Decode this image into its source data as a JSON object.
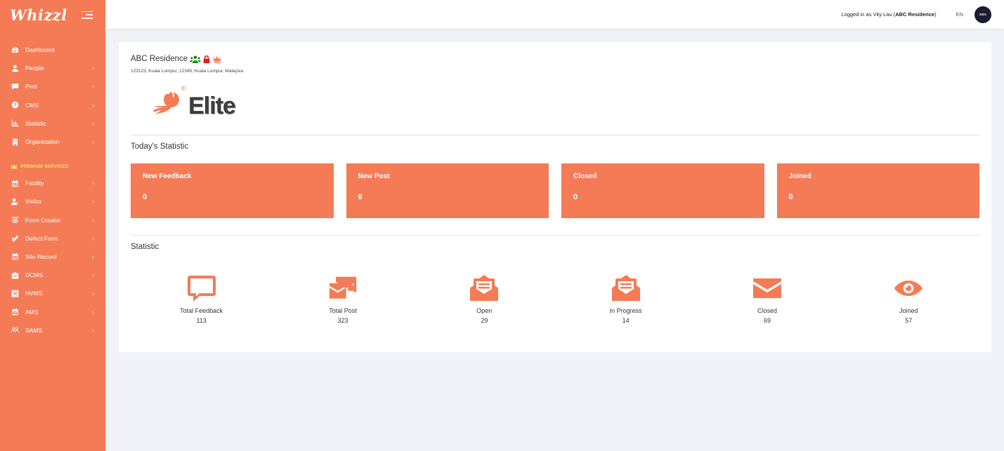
{
  "brand": {
    "name": "Whizzl"
  },
  "sidebar": {
    "items": [
      {
        "label": "Dashboard",
        "icon": "dashboard-icon",
        "has_children": false
      },
      {
        "label": "People",
        "icon": "user-icon",
        "has_children": true
      },
      {
        "label": "Post",
        "icon": "comment-icon",
        "has_children": true
      },
      {
        "label": "CMS",
        "icon": "question-circle-icon",
        "has_children": true
      },
      {
        "label": "Statistic",
        "icon": "chart-icon",
        "has_children": true
      },
      {
        "label": "Organization",
        "icon": "building-icon",
        "has_children": true
      }
    ],
    "premium_title": "PREMIUM SERVICES",
    "premium_items": [
      {
        "label": "Facility",
        "icon": "calendar-icon",
        "has_children": true
      },
      {
        "label": "Visitor",
        "icon": "user-check-icon",
        "has_children": true
      },
      {
        "label": "Form Creator",
        "icon": "align-icon",
        "has_children": true
      },
      {
        "label": "Defect Form",
        "icon": "check-double-icon",
        "has_children": true
      },
      {
        "label": "Site Record",
        "icon": "calendar-icon",
        "has_children": true
      },
      {
        "label": "DCMS",
        "icon": "briefcase-icon",
        "has_children": true
      },
      {
        "label": "HVMS",
        "icon": "h-square-icon",
        "has_children": true
      },
      {
        "label": "AMS",
        "icon": "calendar-check-icon",
        "has_children": true
      },
      {
        "label": "SAMS",
        "icon": "users-icon",
        "has_children": true
      }
    ],
    "chevron": "›"
  },
  "topbar": {
    "logged_in_prefix": "Logged in as Vky Lau (",
    "logged_in_org": "ABC Residence",
    "logged_in_suffix": ")",
    "language": "EN",
    "avatar_text": "2021"
  },
  "organization": {
    "name": "ABC Residence",
    "address": "123123, Kuala Lumpur, 12345, Kuala Lumpur, Malaysia",
    "logo_text": "Elite",
    "logo_reg": "®",
    "badge_colors": {
      "users": "#1e8a1e",
      "lock": "#e01b1b",
      "crown": "#f47b55"
    }
  },
  "today": {
    "heading": "Today's Statistic",
    "boxes": [
      {
        "title": "New Feedback",
        "value": "0"
      },
      {
        "title": "New Post",
        "value": "0"
      },
      {
        "title": "Closed",
        "value": "0"
      },
      {
        "title": "Joined",
        "value": "0"
      }
    ]
  },
  "statistic": {
    "heading": "Statistic",
    "items": [
      {
        "label": "Total Feedback",
        "value": "113",
        "icon": "comment-outline-icon"
      },
      {
        "label": "Total Post",
        "value": "323",
        "icon": "envelopes-icon"
      },
      {
        "label": "Open",
        "value": "29",
        "icon": "envelope-open-text-icon"
      },
      {
        "label": "In Progress",
        "value": "14",
        "icon": "envelope-open-text-icon"
      },
      {
        "label": "Closed",
        "value": "69",
        "icon": "envelope-icon"
      },
      {
        "label": "Joined",
        "value": "57",
        "icon": "eye-icon"
      }
    ]
  },
  "colors": {
    "accent": "#f47b55",
    "premium": "#fde36b",
    "background": "#f1f2f7"
  }
}
